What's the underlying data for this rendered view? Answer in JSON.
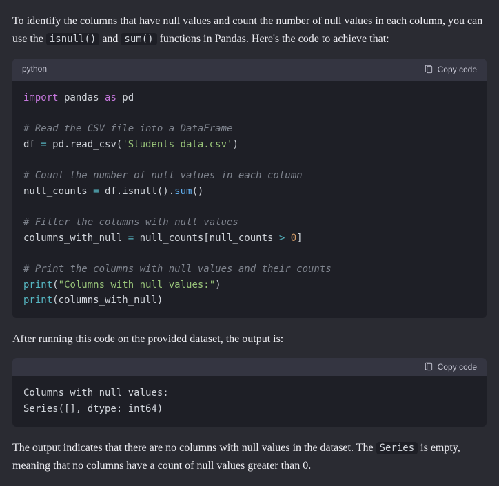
{
  "prose": {
    "p1_a": "To identify the columns that have null values and count the number of null values in each column, you can use the ",
    "p1_code1": "isnull()",
    "p1_b": " and ",
    "p1_code2": "sum()",
    "p1_c": " functions in Pandas. Here's the code to achieve that:",
    "p2": "After running this code on the provided dataset, the output is:",
    "p3_a": "The output indicates that there are no columns with null values in the dataset. The ",
    "p3_code1": "Series",
    "p3_b": " is empty, meaning that no columns have a count of null values greater than 0."
  },
  "codeblock1": {
    "lang": "python",
    "copy_label": "Copy code",
    "lines": {
      "l1_kw": "import",
      "l1_mod": " pandas ",
      "l1_as": "as",
      "l1_alias": " pd",
      "l3_cmt": "# Read the CSV file into a DataFrame",
      "l4_a": "df ",
      "l4_op": "=",
      "l4_b": " pd.read_csv(",
      "l4_str": "'Students data.csv'",
      "l4_c": ")",
      "l6_cmt": "# Count the number of null values in each column",
      "l7_a": "null_counts ",
      "l7_op": "=",
      "l7_b": " df.isnull().",
      "l7_fn": "sum",
      "l7_c": "()",
      "l9_cmt": "# Filter the columns with null values",
      "l10_a": "columns_with_null ",
      "l10_op": "=",
      "l10_b": " null_counts[null_counts ",
      "l10_op2": ">",
      "l10_sp": " ",
      "l10_num": "0",
      "l10_c": "]",
      "l12_cmt": "# Print the columns with null values and their counts",
      "l13_fn": "print",
      "l13_a": "(",
      "l13_str": "\"Columns with null values:\"",
      "l13_b": ")",
      "l14_fn": "print",
      "l14_a": "(columns_with_null)"
    }
  },
  "codeblock2": {
    "lang": "",
    "copy_label": "Copy code",
    "output_l1": "Columns with null values:",
    "output_l2": "Series([], dtype: int64)"
  }
}
